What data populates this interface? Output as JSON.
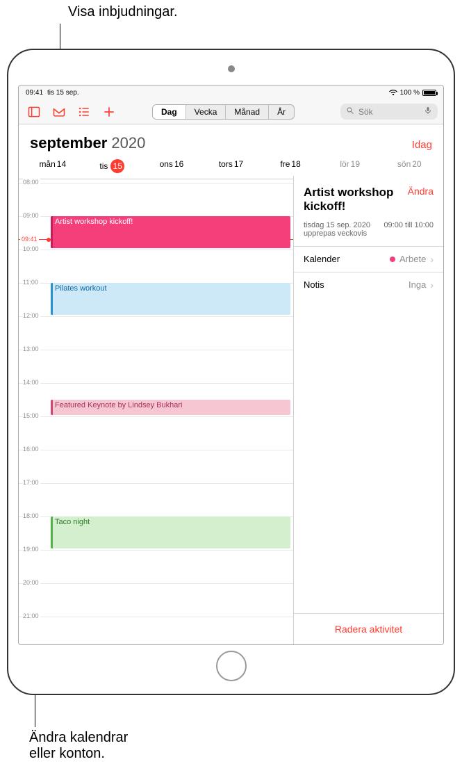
{
  "callouts": {
    "top": "Visa inbjudningar.",
    "bottom_line1": "Ändra kalendrar",
    "bottom_line2": "eller konton."
  },
  "status": {
    "time": "09:41",
    "date": "tis 15 sep.",
    "battery": "100 %"
  },
  "toolbar": {
    "segments": {
      "day": "Dag",
      "week": "Vecka",
      "month": "Månad",
      "year": "År"
    },
    "search_placeholder": "Sök"
  },
  "header": {
    "month": "september",
    "year": "2020",
    "today": "Idag"
  },
  "week": {
    "days": [
      {
        "wd": "mån",
        "num": "14"
      },
      {
        "wd": "tis",
        "num": "15"
      },
      {
        "wd": "ons",
        "num": "16"
      },
      {
        "wd": "tors",
        "num": "17"
      },
      {
        "wd": "fre",
        "num": "18"
      },
      {
        "wd": "lör",
        "num": "19"
      },
      {
        "wd": "sön",
        "num": "20"
      }
    ]
  },
  "hours": [
    "08:00",
    "09:00",
    "10:00",
    "11:00",
    "12:00",
    "13:00",
    "14:00",
    "15:00",
    "16:00",
    "17:00",
    "18:00",
    "19:00",
    "20:00",
    "21:00"
  ],
  "now": "09:41",
  "events_timeline": {
    "e1": "Artist workshop kickoff!",
    "e2": "Pilates workout",
    "e3": "Featured Keynote by Lindsey Bukhari",
    "e4": "Taco night"
  },
  "detail": {
    "title": "Artist workshop kickoff!",
    "edit": "Ändra",
    "date": "tisdag 15 sep. 2020",
    "repeat": "upprepas veckovis",
    "time": "09:00 till 10:00",
    "rows": {
      "calendar_label": "Kalender",
      "calendar_value": "Arbete",
      "alert_label": "Notis",
      "alert_value": "Inga"
    },
    "delete": "Radera aktivitet"
  }
}
